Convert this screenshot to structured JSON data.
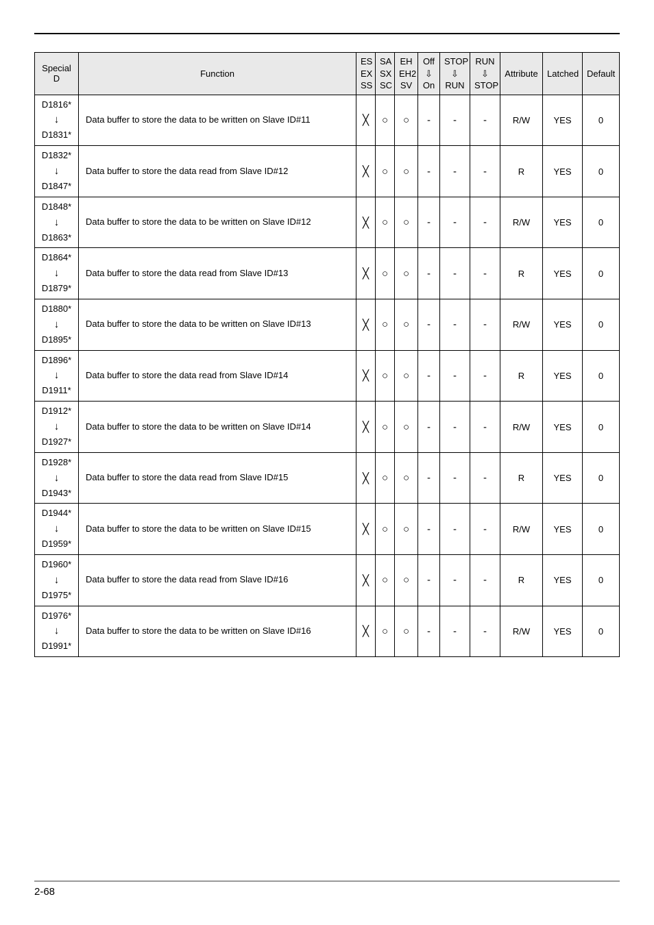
{
  "header": {
    "special_d": "Special D",
    "function": "Function",
    "es_ex_ss": "ES\nEX\nSS",
    "sa_sx_sc": "SA\nSX\nSC",
    "eh_eh2_sv": "EH\nEH2\nSV",
    "off_on": "Off\n⇩\nOn",
    "stop_run": "STOP\n⇩\nRUN",
    "run_stop": "RUN\n⇩\nSTOP",
    "attribute": "Attribute",
    "latched": "Latched",
    "default": "Default"
  },
  "symbols": {
    "cross": "╳",
    "circle": "○",
    "dash": "-"
  },
  "rows": [
    {
      "spd_from": "D1816*",
      "spd_to": "D1831*",
      "function": "Data buffer to store the data to be written on Slave ID#11",
      "es": "cross",
      "sa": "circle",
      "eh": "circle",
      "off": "dash",
      "stop": "dash",
      "run": "dash",
      "attribute": "R/W",
      "latched": "YES",
      "default": "0"
    },
    {
      "spd_from": "D1832*",
      "spd_to": "D1847*",
      "function": "Data buffer to store the data read from Slave ID#12",
      "es": "cross",
      "sa": "circle",
      "eh": "circle",
      "off": "dash",
      "stop": "dash",
      "run": "dash",
      "attribute": "R",
      "latched": "YES",
      "default": "0"
    },
    {
      "spd_from": "D1848*",
      "spd_to": "D1863*",
      "function": "Data buffer to store the data to be written on Slave ID#12",
      "es": "cross",
      "sa": "circle",
      "eh": "circle",
      "off": "dash",
      "stop": "dash",
      "run": "dash",
      "attribute": "R/W",
      "latched": "YES",
      "default": "0"
    },
    {
      "spd_from": "D1864*",
      "spd_to": "D1879*",
      "function": "Data buffer to store the data read from Slave ID#13",
      "es": "cross",
      "sa": "circle",
      "eh": "circle",
      "off": "dash",
      "stop": "dash",
      "run": "dash",
      "attribute": "R",
      "latched": "YES",
      "default": "0"
    },
    {
      "spd_from": "D1880*",
      "spd_to": "D1895*",
      "function": "Data buffer to store the data to be written on Slave ID#13",
      "es": "cross",
      "sa": "circle",
      "eh": "circle",
      "off": "dash",
      "stop": "dash",
      "run": "dash",
      "attribute": "R/W",
      "latched": "YES",
      "default": "0"
    },
    {
      "spd_from": "D1896*",
      "spd_to": "D1911*",
      "function": "Data buffer to store the data read from Slave ID#14",
      "es": "cross",
      "sa": "circle",
      "eh": "circle",
      "off": "dash",
      "stop": "dash",
      "run": "dash",
      "attribute": "R",
      "latched": "YES",
      "default": "0"
    },
    {
      "spd_from": "D1912*",
      "spd_to": "D1927*",
      "function": "Data buffer to store the data to be written on Slave ID#14",
      "es": "cross",
      "sa": "circle",
      "eh": "circle",
      "off": "dash",
      "stop": "dash",
      "run": "dash",
      "attribute": "R/W",
      "latched": "YES",
      "default": "0"
    },
    {
      "spd_from": "D1928*",
      "spd_to": "D1943*",
      "function": "Data buffer to store the data read from Slave ID#15",
      "es": "cross",
      "sa": "circle",
      "eh": "circle",
      "off": "dash",
      "stop": "dash",
      "run": "dash",
      "attribute": "R",
      "latched": "YES",
      "default": "0"
    },
    {
      "spd_from": "D1944*",
      "spd_to": "D1959*",
      "function": "Data buffer to store the data to be written on Slave ID#15",
      "es": "cross",
      "sa": "circle",
      "eh": "circle",
      "off": "dash",
      "stop": "dash",
      "run": "dash",
      "attribute": "R/W",
      "latched": "YES",
      "default": "0"
    },
    {
      "spd_from": "D1960*",
      "spd_to": "D1975*",
      "function": "Data buffer to store the data read from Slave ID#16",
      "es": "cross",
      "sa": "circle",
      "eh": "circle",
      "off": "dash",
      "stop": "dash",
      "run": "dash",
      "attribute": "R",
      "latched": "YES",
      "default": "0"
    },
    {
      "spd_from": "D1976*",
      "spd_to": "D1991*",
      "function": "Data buffer to store the data to be written on Slave ID#16",
      "es": "cross",
      "sa": "circle",
      "eh": "circle",
      "off": "dash",
      "stop": "dash",
      "run": "dash",
      "attribute": "R/W",
      "latched": "YES",
      "default": "0"
    }
  ],
  "footer": {
    "page": "2-68"
  }
}
